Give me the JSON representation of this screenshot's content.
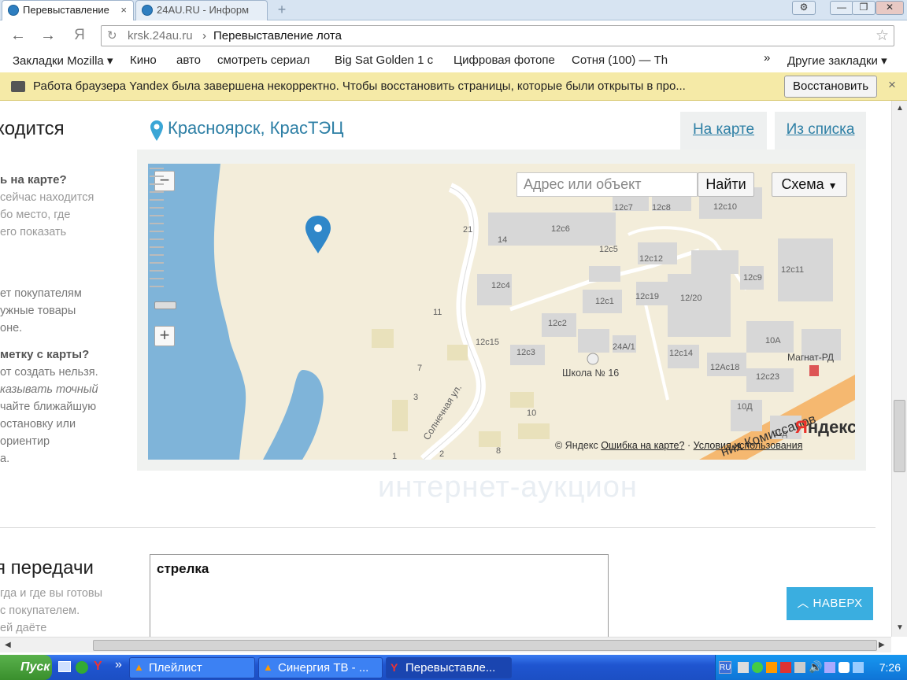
{
  "browser": {
    "tabs": [
      {
        "title": "Перевыставление",
        "close": "×"
      },
      {
        "title": "24AU.RU - Информ"
      }
    ],
    "new_tab": "+",
    "window": {
      "settings": "⚙",
      "minimize": "—",
      "maximize": "❐",
      "close": "✕"
    },
    "nav": {
      "back": "←",
      "forward": "→",
      "yandex": "Я"
    },
    "url": {
      "host": "krsk.24au.ru",
      "separator": "›",
      "title": "Перевыставление лота"
    },
    "bookmarks": [
      "Закладки Mozilla",
      "Кино",
      "авто",
      "смотреть сериал",
      "Big Sat Golden 1 c",
      "Цифровая фотопе",
      "Сотня (100) — Th"
    ],
    "bookmarks_more": "»",
    "bookmarks_other": "Другие закладки",
    "infobar": {
      "text": "Работа браузера Yandex была завершена некорректно. Чтобы восстановить страницы, которые были открыты в про...",
      "restore": "Восстановить",
      "close": "×"
    }
  },
  "page": {
    "section_title": "ходится",
    "sidebar": {
      "q1": "ь на карте?",
      "p1": [
        "сейчас находится",
        "бо место, где",
        "его показать"
      ],
      "p2": [
        "ет покупателям",
        "ужные товары",
        "оне."
      ],
      "q2": "метку с карты?",
      "p3": [
        "от создать нельзя.",
        "казывать точный",
        "чайте ближайшую",
        "остановку или",
        "ориентир",
        "а."
      ]
    },
    "location": "Красноярск, КрасТЭЦ",
    "view_tabs": {
      "map": "На карте",
      "list": "Из списка"
    },
    "map": {
      "search_placeholder": "Адрес или объект",
      "find": "Найти",
      "type": "Схема",
      "zoom_in": "+",
      "zoom_out": "−",
      "copyright": "© Яндекс",
      "error_link": "Ошибка на карте?",
      "dot": "·",
      "terms_link": "Условия использования",
      "logo_y": "Я",
      "logo_rest": "ндекс",
      "labels": {
        "l21": "21",
        "l14": "14",
        "l11": "11",
        "l7": "7",
        "l3": "3",
        "l1": "1",
        "l2": "2",
        "l8": "8",
        "l10": "10",
        "b12c7": "12c7",
        "b12c8": "12c8",
        "b12c10": "12c10",
        "b12c6": "12c6",
        "b12c5": "12c5",
        "b12c12": "12c12",
        "b12c11": "12c11",
        "b12c9": "12c9",
        "b12c4": "12c4",
        "b12c1": "12c1",
        "b12c19": "12c19",
        "b12_20": "12/20",
        "b12c2": "12c2",
        "b12c15": "12c15",
        "b12c3": "12c3",
        "b24a1": "24А/1",
        "b12c14": "12c14",
        "b10a": "10А",
        "school": "Школа № 16",
        "b12ac18": "12Ас18",
        "b12c23": "12c23",
        "magnet": "Магнат-РД",
        "b10d": "10Д",
        "b11d": "11д",
        "street1": "Солнечная ул.",
        "street2": "них Комиссаров"
      }
    },
    "watermark": "интернет-аукцион",
    "delivery_title": "я передачи",
    "delivery_side": [
      "гда и где вы готовы",
      "с покупателем.",
      "ей даёте"
    ],
    "delivery_value": "стрелка",
    "top_button": "НАВЕРХ"
  },
  "taskbar": {
    "start": "Пуск",
    "more": "»",
    "tasks": [
      "Плейлист",
      "Синергия ТВ - ...",
      "Перевыставле..."
    ],
    "lang": "RU",
    "time": "7:26"
  },
  "colors": {
    "link": "#2d7fa5",
    "infobar": "#f5eaa7",
    "top_button": "#3aaee0",
    "water": "#7fb4d9",
    "taskbar": "#245edb"
  }
}
